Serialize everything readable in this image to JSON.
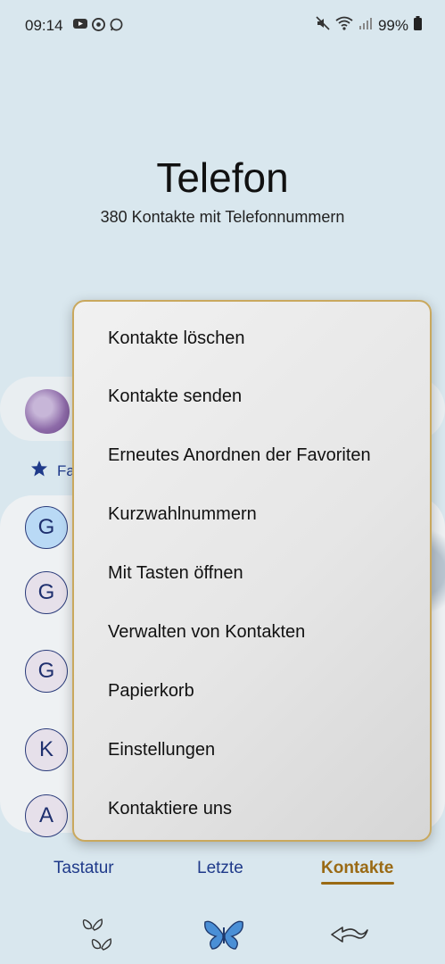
{
  "status_bar": {
    "time": "09:14",
    "battery": "99%",
    "left_icons": [
      "youtube-icon",
      "chrome-icon",
      "whatsapp-icon"
    ],
    "right_icons": [
      "mute-icon",
      "wifi-icon",
      "signal-icon",
      "battery-icon"
    ]
  },
  "header": {
    "title": "Telefon",
    "subtitle": "380 Kontakte mit Telefonnummern"
  },
  "background": {
    "favorites_label": "Fa",
    "contact_letters": [
      "G",
      "G",
      "G",
      "K",
      "A"
    ]
  },
  "menu": {
    "items": [
      "Kontakte löschen",
      "Kontakte senden",
      "Erneutes Anordnen der Favoriten",
      "Kurzwahlnummern",
      "Mit Tasten öffnen",
      "Verwalten von Kontakten",
      "Papierkorb",
      "Einstellungen",
      "Kontaktiere uns"
    ]
  },
  "tabs": {
    "keypad": "Tastatur",
    "recents": "Letzte",
    "contacts": "Kontakte",
    "active": "Kontakte"
  },
  "colors": {
    "background": "#d9e7ee",
    "accent_gold": "#9a6a14",
    "tab_blue": "#1f3a8a",
    "menu_border": "#c9a85e"
  },
  "nav_icons": [
    "recents-button-icon",
    "home-butterfly-icon",
    "back-arrow-icon"
  ]
}
